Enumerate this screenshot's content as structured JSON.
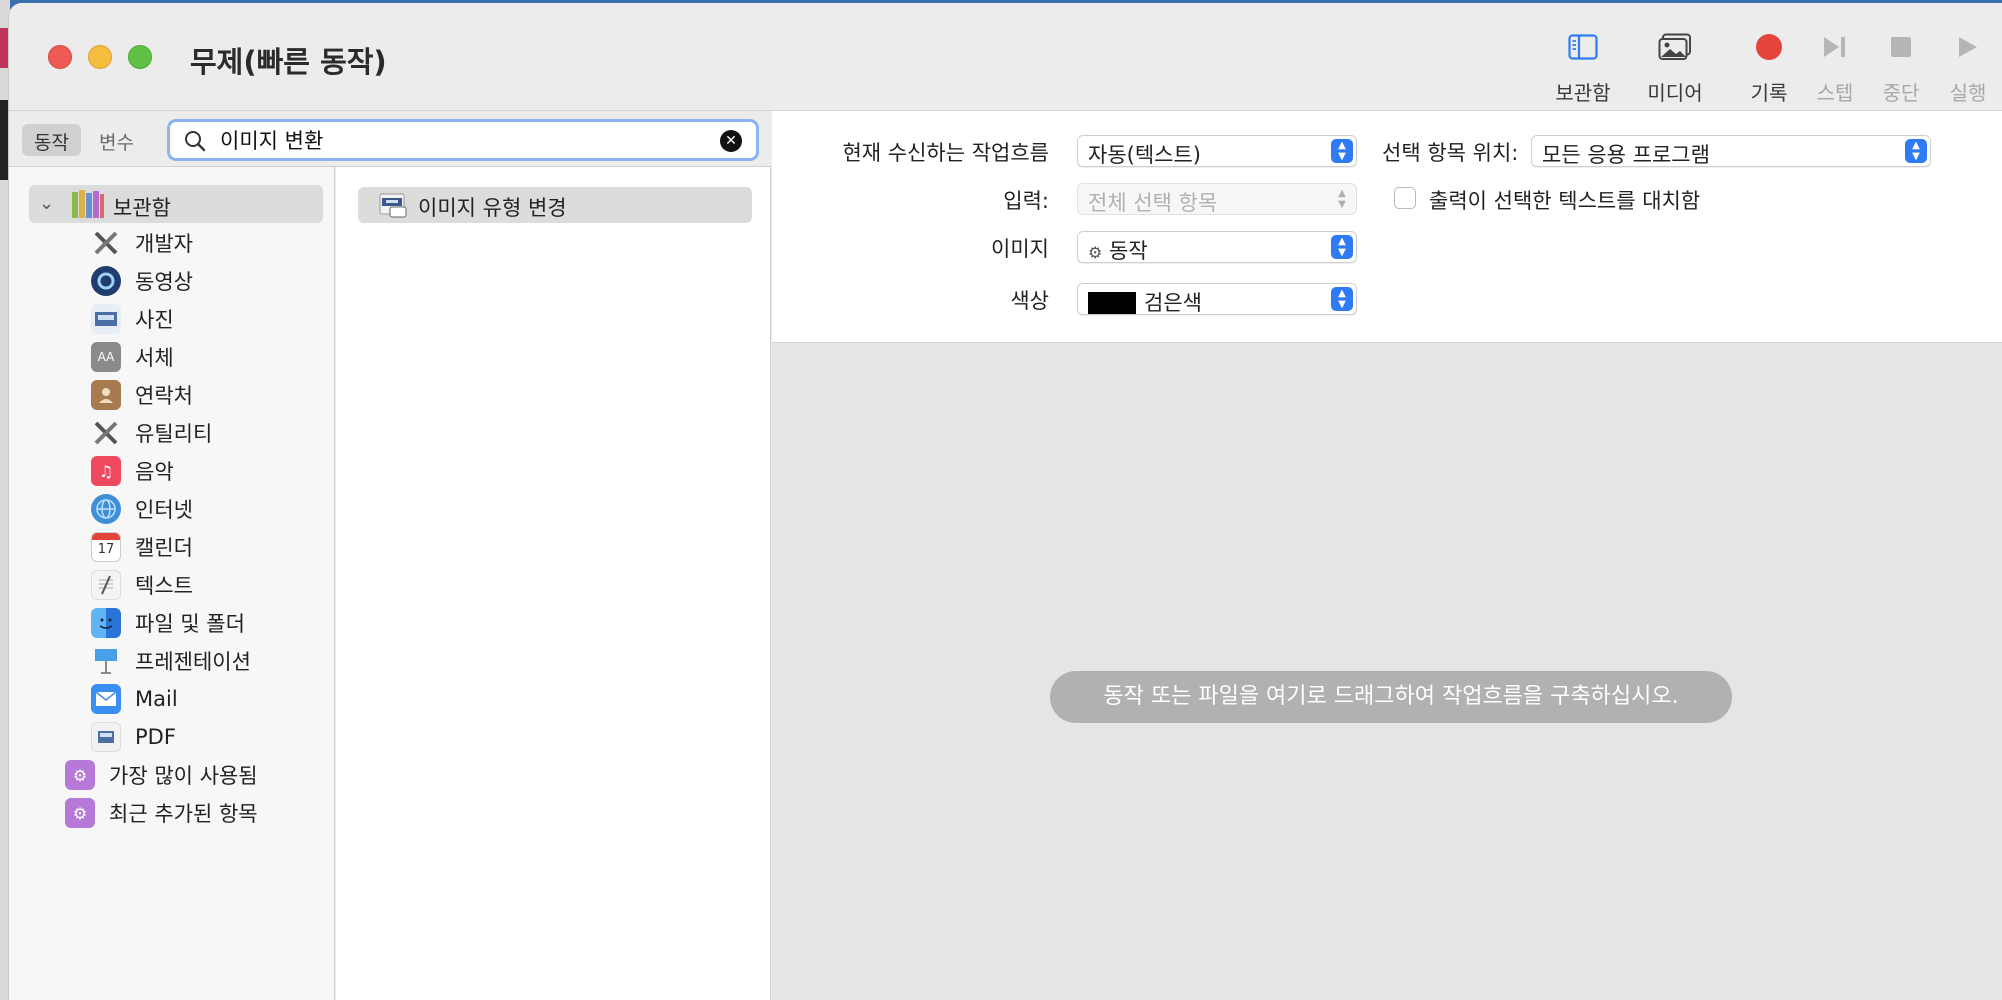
{
  "window": {
    "title": "무제(빠른 동작)"
  },
  "toolbar": {
    "library_label": "보관함",
    "media_label": "미디어",
    "record_label": "기록",
    "step_label": "스텝",
    "stop_label": "중단",
    "run_label": "실행"
  },
  "sidebar": {
    "tabs": {
      "actions": "동작",
      "variables": "변수"
    },
    "search": {
      "value": "이미지 변환"
    },
    "root": "보관함",
    "items": [
      {
        "label": "개발자",
        "icon": "tools-icon"
      },
      {
        "label": "동영상",
        "icon": "video-icon"
      },
      {
        "label": "사진",
        "icon": "photo-icon"
      },
      {
        "label": "서체",
        "icon": "font-icon"
      },
      {
        "label": "연락처",
        "icon": "contacts-icon"
      },
      {
        "label": "유틸리티",
        "icon": "tools-icon"
      },
      {
        "label": "음악",
        "icon": "music-icon"
      },
      {
        "label": "인터넷",
        "icon": "globe-icon"
      },
      {
        "label": "캘린더",
        "icon": "calendar-icon",
        "calendar_day": "17"
      },
      {
        "label": "텍스트",
        "icon": "text-icon"
      },
      {
        "label": "파일 및 폴더",
        "icon": "finder-icon"
      },
      {
        "label": "프레젠테이션",
        "icon": "presentation-icon"
      },
      {
        "label": "Mail",
        "icon": "mail-icon"
      },
      {
        "label": "PDF",
        "icon": "pdf-icon"
      }
    ],
    "smart_folders": [
      "가장 많이 사용됨",
      "최근 추가된 항목"
    ]
  },
  "actions": {
    "results": [
      "이미지 유형 변경"
    ]
  },
  "settings": {
    "workflow_receives_label": "현재 수신하는 작업흐름",
    "workflow_receives_value": "자동(텍스트)",
    "in_label": "선택 항목 위치:",
    "in_value": "모든 응용 프로그램",
    "input_label": "입력:",
    "input_value": "전체 선택 항목",
    "replace_label": "출력이 선택한 텍스트를 대치함",
    "image_label": "이미지",
    "image_value": "동작",
    "color_label": "색상",
    "color_value": "검은색"
  },
  "canvas": {
    "hint": "동작 또는 파일을 여기로 드래그하여 작업흐름을 구축하십시오."
  },
  "colors": {
    "accent": "#2f7bf5",
    "record": "#e5443b"
  }
}
